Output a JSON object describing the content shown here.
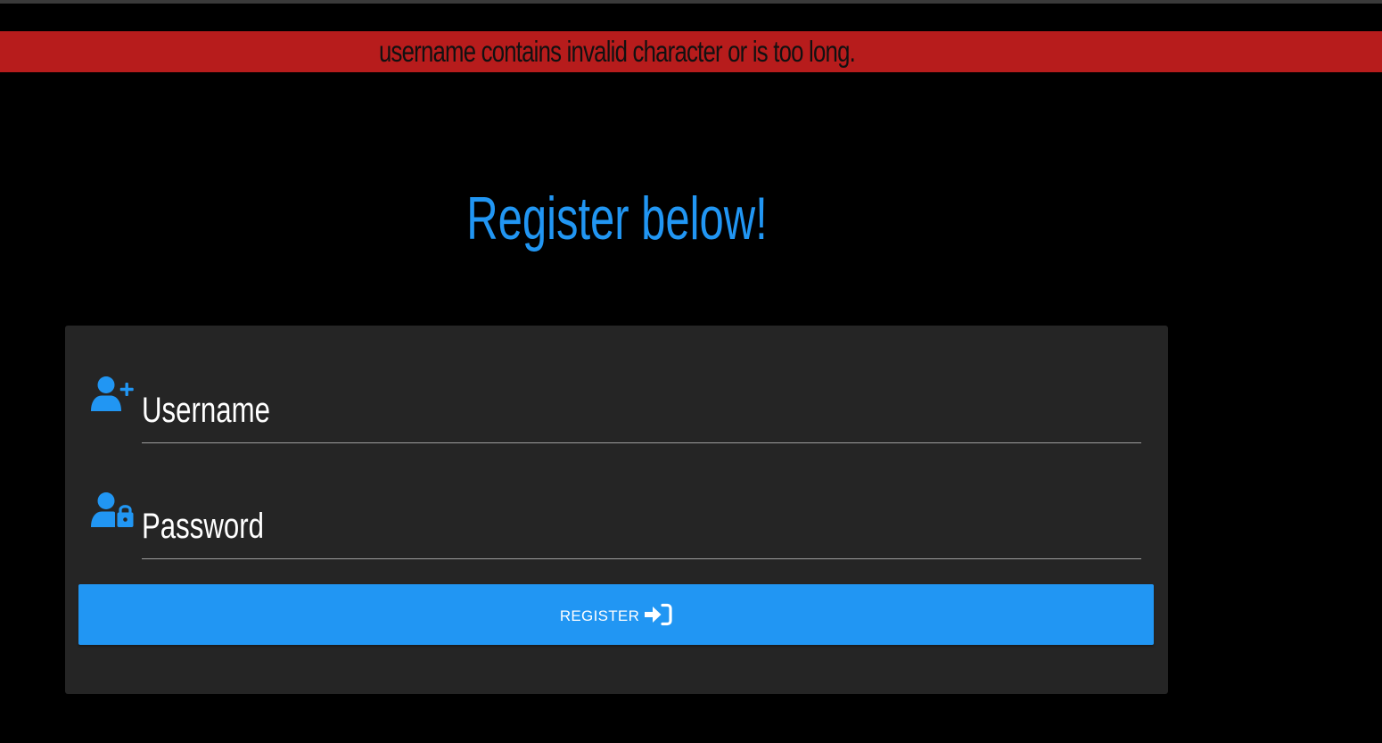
{
  "error_banner": {
    "message": "username contains invalid character or is too long."
  },
  "page": {
    "title": "Register below!"
  },
  "form": {
    "username": {
      "label": "Username",
      "icon": "user-plus-icon",
      "value": ""
    },
    "password": {
      "label": "Password",
      "icon": "user-lock-icon",
      "value": ""
    },
    "submit": {
      "label": "REGISTER",
      "icon": "sign-in-icon"
    }
  },
  "colors": {
    "background": "#000000",
    "error_banner": "#b71c1c",
    "accent": "#2196f3",
    "card": "#252525"
  }
}
